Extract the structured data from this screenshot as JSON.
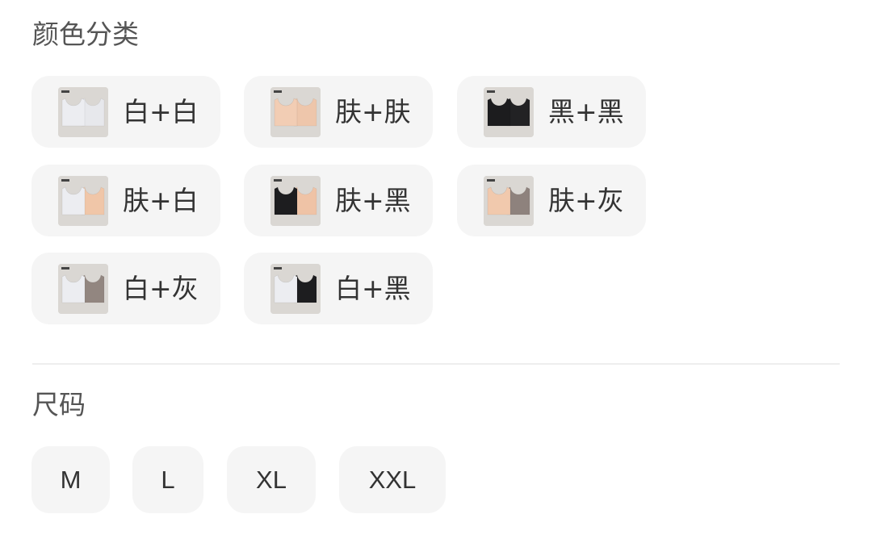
{
  "color_section": {
    "title": "颜色分类",
    "options": [
      {
        "label": "白+白",
        "image": "bra-pair-white-white",
        "colors": [
          "#ecedf1",
          "#e7e8ec"
        ]
      },
      {
        "label": "肤+肤",
        "image": "bra-pair-nude-nude",
        "colors": [
          "#f2cdb4",
          "#eec6ab"
        ]
      },
      {
        "label": "黑+黑",
        "image": "bra-pair-black-black",
        "colors": [
          "#1c1c1e",
          "#222224"
        ]
      },
      {
        "label": "肤+白",
        "image": "bra-pair-nude-white",
        "colors": [
          "#ecedf1",
          "#f0c6a8"
        ]
      },
      {
        "label": "肤+黑",
        "image": "bra-pair-nude-black",
        "colors": [
          "#1d1d1f",
          "#efc3a6"
        ]
      },
      {
        "label": "肤+灰",
        "image": "bra-pair-nude-gray",
        "colors": [
          "#f1c9ad",
          "#8e827d"
        ]
      },
      {
        "label": "白+灰",
        "image": "bra-pair-white-gray",
        "colors": [
          "#ecedf1",
          "#928680"
        ]
      },
      {
        "label": "白+黑",
        "image": "bra-pair-white-black",
        "colors": [
          "#ecedf1",
          "#1d1d1f"
        ]
      }
    ]
  },
  "size_section": {
    "title": "尺码",
    "options": [
      {
        "label": "M"
      },
      {
        "label": "L"
      },
      {
        "label": "XL"
      },
      {
        "label": "XXL"
      }
    ]
  }
}
